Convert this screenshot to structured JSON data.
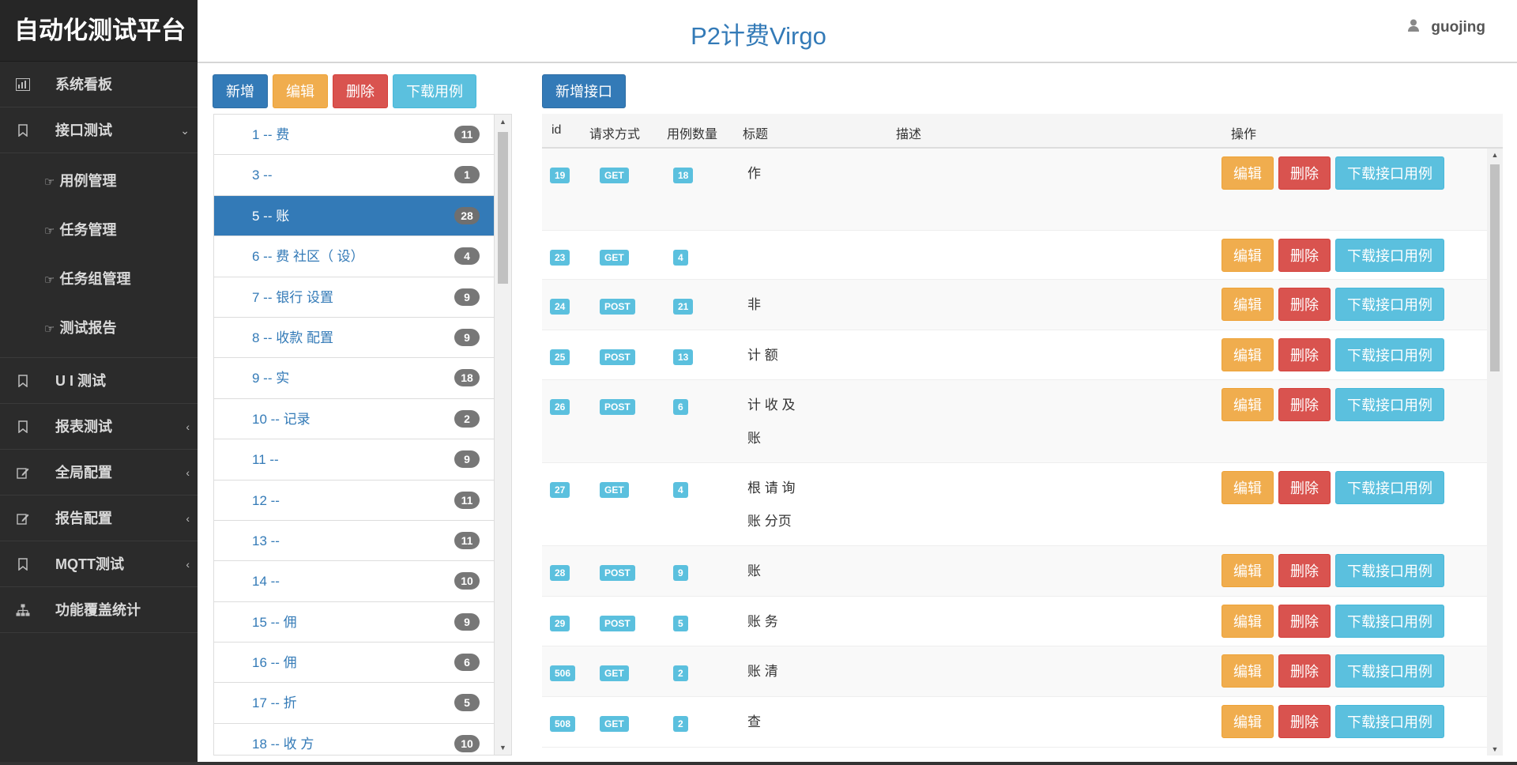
{
  "sidebar": {
    "brand": "自动化测试平台",
    "items": [
      {
        "label": "系统看板",
        "icon": "bar-chart-icon"
      },
      {
        "label": "接口测试",
        "icon": "bookmark-icon",
        "expanded": true,
        "children": [
          {
            "label": "用例管理",
            "icon": "hand-pointer-icon"
          },
          {
            "label": "任务管理",
            "icon": "hand-pointer-icon"
          },
          {
            "label": "任务组管理",
            "icon": "hand-pointer-icon"
          },
          {
            "label": "测试报告",
            "icon": "hand-pointer-icon"
          }
        ]
      },
      {
        "label": "U I 测试",
        "icon": "bookmark-icon"
      },
      {
        "label": "报表测试",
        "icon": "bookmark-icon"
      },
      {
        "label": "全局配置",
        "icon": "edit-icon"
      },
      {
        "label": "报告配置",
        "icon": "edit-icon"
      },
      {
        "label": "MQTT测试",
        "icon": "bookmark-icon"
      },
      {
        "label": "功能覆盖统计",
        "icon": "sitemap-icon"
      }
    ]
  },
  "header": {
    "title": "P2计费Virgo",
    "user": "guojing"
  },
  "left_toolbar": {
    "add": "新增",
    "edit": "编辑",
    "delete": "删除",
    "download": "下载用例"
  },
  "right_toolbar": {
    "add_api": "新增接口"
  },
  "modules": [
    {
      "label": "1 -- 费",
      "count": "11"
    },
    {
      "label": "3 -- ",
      "count": "1"
    },
    {
      "label": "5 -- 账",
      "count": "28",
      "active": true
    },
    {
      "label": "6 -- 费  社区（  设）",
      "count": "4"
    },
    {
      "label": "7 -- 银行  设置",
      "count": "9"
    },
    {
      "label": "8 -- 收款  配置",
      "count": "9"
    },
    {
      "label": "9 -- 实",
      "count": "18"
    },
    {
      "label": "10 --   记录",
      "count": "2"
    },
    {
      "label": "11 --",
      "count": "9"
    },
    {
      "label": "12 --",
      "count": "11"
    },
    {
      "label": "13 --",
      "count": "11"
    },
    {
      "label": "14 --",
      "count": "10"
    },
    {
      "label": "15 -- 佣",
      "count": "9"
    },
    {
      "label": "16 -- 佣",
      "count": "6"
    },
    {
      "label": "17 -- 折",
      "count": "5"
    },
    {
      "label": "18 -- 收  方",
      "count": "10"
    }
  ],
  "table": {
    "columns": {
      "id": "id",
      "method": "请求方式",
      "count": "用例数量",
      "title": "标题",
      "desc": "描述",
      "ops": "操作"
    },
    "ops_labels": {
      "edit": "编辑",
      "delete": "删除",
      "download": "下载接口用例"
    },
    "rows": [
      {
        "id": "19",
        "method": "GET",
        "count": "18",
        "title": "作",
        "title2": ""
      },
      {
        "id": "23",
        "method": "GET",
        "count": "4",
        "title": "",
        "title2": ""
      },
      {
        "id": "24",
        "method": "POST",
        "count": "21",
        "title": "非",
        "title2": ""
      },
      {
        "id": "25",
        "method": "POST",
        "count": "13",
        "title": "计  额",
        "title2": ""
      },
      {
        "id": "26",
        "method": "POST",
        "count": "6",
        "title": "计  收  及",
        "title2": "账"
      },
      {
        "id": "27",
        "method": "GET",
        "count": "4",
        "title": "根  请  询",
        "title2": "账  分页"
      },
      {
        "id": "28",
        "method": "POST",
        "count": "9",
        "title": "账",
        "title2": ""
      },
      {
        "id": "29",
        "method": "POST",
        "count": "5",
        "title": "账  务",
        "title2": ""
      },
      {
        "id": "506",
        "method": "GET",
        "count": "2",
        "title": "账  清",
        "title2": ""
      },
      {
        "id": "508",
        "method": "GET",
        "count": "2",
        "title": "查",
        "title2": ""
      }
    ]
  }
}
